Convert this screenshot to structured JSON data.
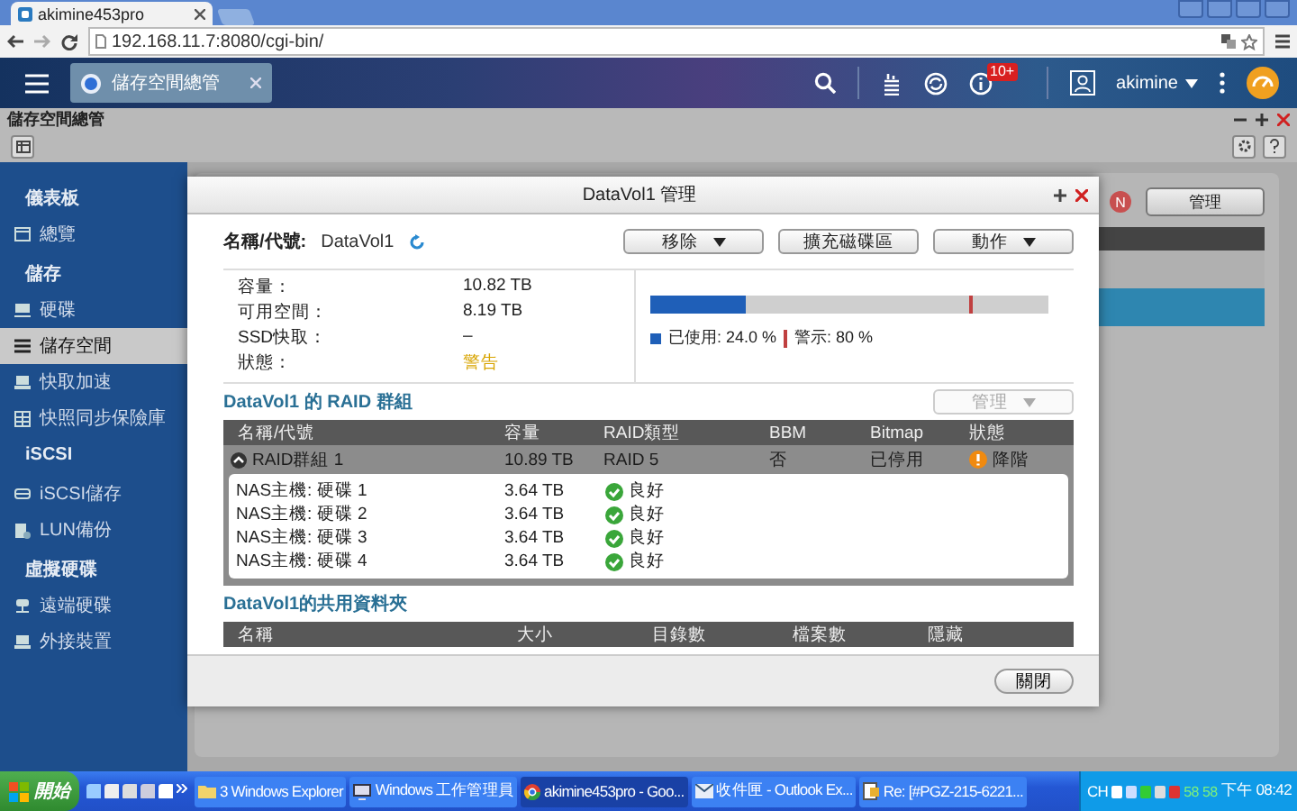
{
  "browser": {
    "tab_title": "akimine453pro",
    "url": "192.168.11.7:8080/cgi-bin/"
  },
  "top_bar": {
    "app_tab": "儲存空間總管",
    "notification_badge": "10+",
    "user": "akimine"
  },
  "app": {
    "title": "儲存空間總管"
  },
  "sidebar": {
    "sections": [
      {
        "title": "儀表板",
        "items": [
          {
            "label": "總覽",
            "selected": false
          }
        ]
      },
      {
        "title": "儲存",
        "items": [
          {
            "label": "硬碟",
            "selected": false
          },
          {
            "label": "儲存空間",
            "selected": true
          },
          {
            "label": "快取加速",
            "selected": false
          },
          {
            "label": "快照同步保險庫",
            "selected": false
          }
        ]
      },
      {
        "title": "iSCSI",
        "items": [
          {
            "label": "iSCSI儲存",
            "selected": false
          },
          {
            "label": "LUN備份",
            "selected": false
          }
        ]
      },
      {
        "title": "虛擬硬碟",
        "items": [
          {
            "label": "遠端硬碟",
            "selected": false
          },
          {
            "label": "外接裝置",
            "selected": false
          }
        ]
      }
    ]
  },
  "background_panel": {
    "badge": "N",
    "button": "管理",
    "rows": [
      {
        "selected": false
      },
      {
        "selected": true
      }
    ]
  },
  "dialog": {
    "title": "DataVol1 管理",
    "name_label": "名稱/代號:",
    "name": "DataVol1",
    "buttons": [
      {
        "label": "移除",
        "dropdown": true
      },
      {
        "label": "擴充磁碟區",
        "dropdown": false
      },
      {
        "label": "動作",
        "dropdown": true
      }
    ],
    "info": [
      {
        "label": "容量：",
        "value": "10.82 TB",
        "kind": "plain"
      },
      {
        "label": "可用空間：",
        "value": "8.19 TB",
        "kind": "plain"
      },
      {
        "label": "SSD快取：",
        "value": "–",
        "kind": "plain"
      },
      {
        "label": "狀態：",
        "value": "警告",
        "kind": "warning"
      }
    ],
    "usage": {
      "level": 0.24,
      "used_label": "已使用: 24.0 %",
      "warning": {
        "label": "警示: 80 %",
        "level": 0.8
      }
    },
    "raid_section": {
      "title": "DataVol1 的 RAID 群組",
      "manage_button": {
        "label": "管理",
        "disabled": true
      },
      "columns": [
        "名稱/代號",
        "容量",
        "RAID類型",
        "BBM",
        "Bitmap",
        "狀態"
      ],
      "groups": [
        {
          "name": "RAID群組 1",
          "capacity": "10.89 TB",
          "raid_type": "RAID 5",
          "bbm": "否",
          "bitmap": "已停用",
          "status": {
            "text": "降階",
            "kind": "warning"
          },
          "expanded": true,
          "disks": [
            {
              "name": "NAS主機: 硬碟 1",
              "capacity": "3.64 TB",
              "status": {
                "text": "良好",
                "kind": "good"
              }
            },
            {
              "name": "NAS主機: 硬碟 2",
              "capacity": "3.64 TB",
              "status": {
                "text": "良好",
                "kind": "good"
              }
            },
            {
              "name": "NAS主機: 硬碟 3",
              "capacity": "3.64 TB",
              "status": {
                "text": "良好",
                "kind": "good"
              }
            },
            {
              "name": "NAS主機: 硬碟 4",
              "capacity": "3.64 TB",
              "status": {
                "text": "良好",
                "kind": "good"
              }
            }
          ]
        }
      ]
    },
    "shared_section": {
      "title": "DataVol1的共用資料夾",
      "columns": [
        "名稱",
        "大小",
        "目錄數",
        "檔案數",
        "隱藏"
      ]
    },
    "close_button": "關閉"
  },
  "taskbar": {
    "start": "開始",
    "tasks": [
      {
        "label": "3 Windows Explorer",
        "selected": false
      },
      {
        "label": "Windows 工作管理員",
        "selected": false
      },
      {
        "label": "akimine453pro - Goo...",
        "selected": true
      },
      {
        "label": "收件匣 - Outlook Ex...",
        "selected": false
      },
      {
        "label": "Re: [#PGZ-215-6221...",
        "selected": false
      }
    ],
    "tray": {
      "language": "CH",
      "numbers": [
        "58",
        "58"
      ],
      "clock": "下午 08:42"
    }
  }
}
